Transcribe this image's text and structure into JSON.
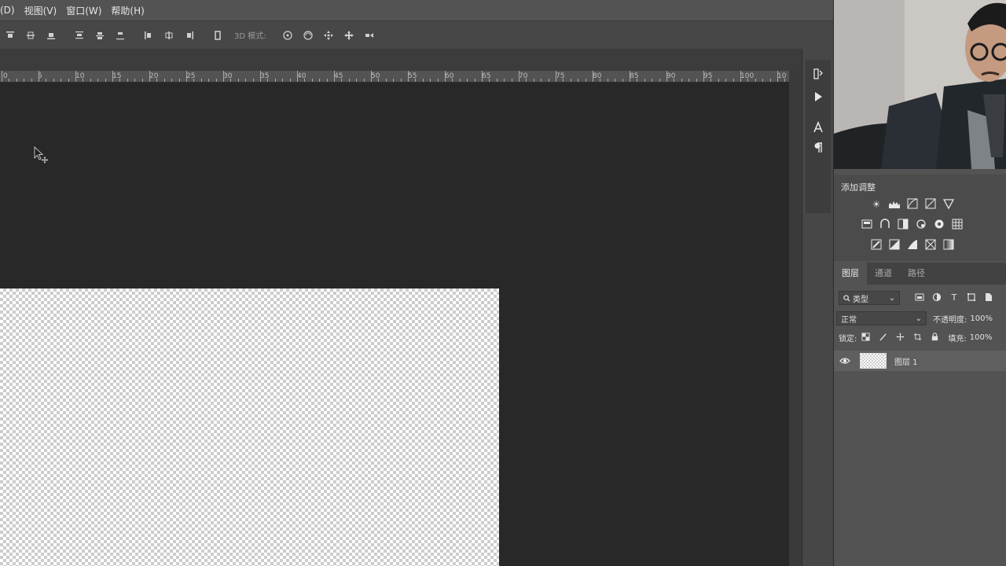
{
  "menu": {
    "items": [
      "(D)",
      "视图(V)",
      "窗口(W)",
      "帮助(H)"
    ]
  },
  "options_bar": {
    "mode_3d_label": "3D 模式:"
  },
  "ruler": {
    "labels": [
      "0",
      "5",
      "10",
      "15",
      "20",
      "25",
      "30",
      "35",
      "40",
      "45",
      "50",
      "55",
      "60",
      "65",
      "70",
      "75",
      "80",
      "85",
      "90",
      "95",
      "100",
      "10"
    ]
  },
  "adjustments": {
    "title": "添加调整"
  },
  "layers_panel": {
    "tabs": [
      "图层",
      "通道",
      "路径"
    ],
    "filter_kind": "类型",
    "blend_mode": "正常",
    "opacity_label": "不透明度:",
    "opacity_value": "100%",
    "lock_label": "锁定:",
    "fill_label": "填充:",
    "fill_value": "100%",
    "layers": [
      {
        "name": "图层 1",
        "visible": true
      }
    ]
  },
  "colors": {
    "accent": "#535353",
    "pasteboard": "#282828"
  }
}
